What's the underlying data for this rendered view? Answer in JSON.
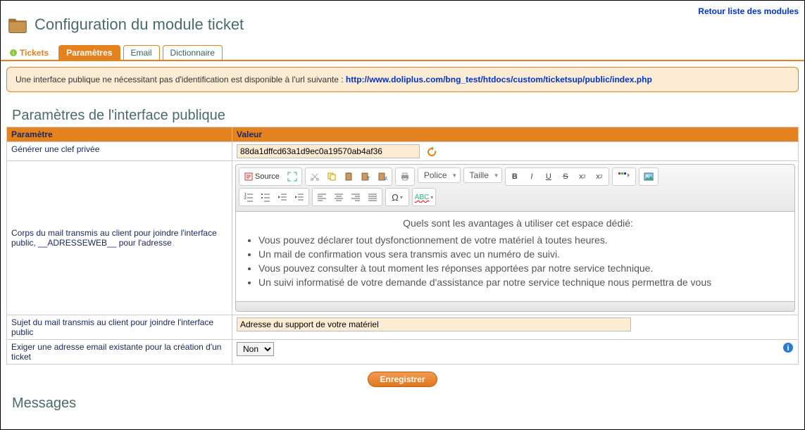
{
  "header": {
    "title": "Configuration du module ticket",
    "back_link": "Retour liste des modules"
  },
  "tabs": {
    "tickets": "Tickets",
    "params": "Paramètres",
    "email": "Email",
    "dict": "Dictionnaire"
  },
  "notice": {
    "text": "Une interface publique ne nécessitant pas d'identification est disponible à l'url suivante : ",
    "url": "http://www.doliplus.com/bng_test/htdocs/custom/ticketsup/public/index.php"
  },
  "section1": {
    "title": "Paramètres de l'interface publique"
  },
  "table": {
    "col_param": "Paramètre",
    "col_value": "Valeur",
    "row_key": {
      "label": "Générer une clef privée",
      "value": "88da1dffcd63a1d9ec0a19570ab4af36"
    },
    "row_body": {
      "label": "Corps du mail transmis au client pour joindre l'interface public, __ADRESSEWEB__ pour l'adresse"
    },
    "row_subject": {
      "label": "Sujet du mail transmis au client pour joindre l'interface public",
      "value": "Adresse du support de votre matériel"
    },
    "row_require_email": {
      "label": "Exiger une adresse email existante pour la création d'un ticket",
      "value": "Non"
    }
  },
  "editor": {
    "source_label": "Source",
    "font_select": "Police",
    "size_select": "Taille",
    "content": {
      "intro": "Quels sont les avantages à utiliser cet espace dédié:",
      "li1": "Vous pouvez déclarer tout dysfonctionnement de votre matériel à toutes heures.",
      "li2": "Un mail de confirmation vous sera transmis avec un numéro de suivi.",
      "li3": "Vous pouvez consulter à tout moment les réponses apportées par notre service technique.",
      "li4": "Un suivi informatisé de votre demande d'assistance par notre service technique nous permettra de vous"
    }
  },
  "buttons": {
    "save": "Enregistrer"
  },
  "section2": {
    "title": "Messages"
  }
}
